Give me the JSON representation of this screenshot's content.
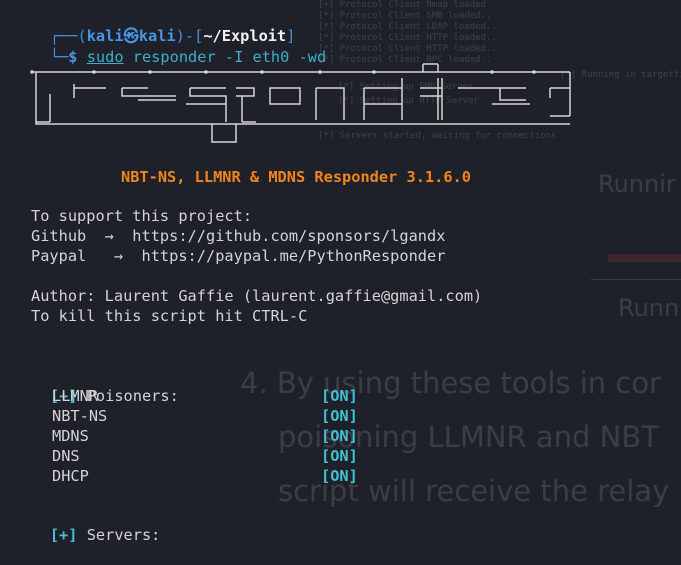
{
  "background_text": {
    "faint_lines": [
      "[+] Protocol Client Nmap loaded",
      "[*] Protocol Client SMB loaded..",
      "[*] Protocol Client LDAP loaded..",
      "[*] Protocol Client HTTP loaded..",
      "[*] Protocol Client HTTP loaded..",
      "[*] Protocol Client RPC loaded..",
      "[*] Running in targetfile mode",
      "[*] Setting up SMB Server",
      "[*] Setting up HTTP Server",
      "",
      "[*] Servers started, waiting for connections"
    ],
    "big_1": "Runnir",
    "big_2": "Runn",
    "paragraph": [
      "4. By using these tools in cor",
      "poisoning LLMNR and NBT",
      "script will receive the relay"
    ]
  },
  "prompt": {
    "open": "┌──(",
    "user": "kali",
    "at": "㉿",
    "host": "kali",
    "close": ")-[",
    "path": "~/Exploit",
    "end": "]",
    "corner": "└─",
    "dollar": "$",
    "cmd_sudo": "sudo",
    "cmd_program": "responder",
    "cmd_args": "-I eth0 -wd"
  },
  "banner_title": "NBT-NS, LLMNR & MDNS Responder 3.1.6.0",
  "support_lines": [
    "To support this project:",
    "Github  →  https://github.com/sponsors/lgandx",
    "Paypal   →  https://paypal.me/PythonResponder"
  ],
  "author_lines": [
    "Author: Laurent Gaffie (laurent.gaffie@gmail.com)",
    "To kill this script hit CTRL-C"
  ],
  "poisoners": {
    "marker": "[+]",
    "heading": "Poisoners:",
    "items": [
      {
        "name": "LLMNR",
        "status": "[ON]"
      },
      {
        "name": "NBT-NS",
        "status": "[ON]"
      },
      {
        "name": "MDNS",
        "status": "[ON]"
      },
      {
        "name": "DNS",
        "status": "[ON]"
      },
      {
        "name": "DHCP",
        "status": "[ON]"
      }
    ]
  },
  "servers": {
    "marker": "[+]",
    "heading": "Servers:"
  },
  "colors": {
    "background": "#1e2129",
    "accent_blue": "#3f8fe0",
    "banner_orange": "#f0851f",
    "status_cyan": "#44c0d2",
    "prompt_green": "#49c46a"
  }
}
